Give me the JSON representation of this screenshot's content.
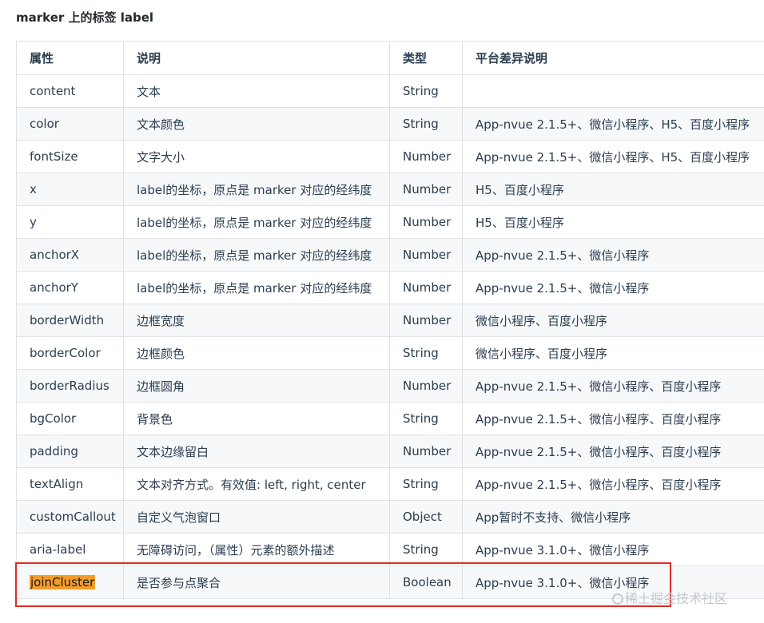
{
  "heading": "marker 上的标签 label",
  "table": {
    "headers": [
      "属性",
      "说明",
      "类型",
      "平台差异说明"
    ],
    "rows": [
      [
        "content",
        "文本",
        "String",
        ""
      ],
      [
        "color",
        "文本颜色",
        "String",
        "App-nvue 2.1.5+、微信小程序、H5、百度小程序"
      ],
      [
        "fontSize",
        "文字大小",
        "Number",
        "App-nvue 2.1.5+、微信小程序、H5、百度小程序"
      ],
      [
        "x",
        "label的坐标，原点是 marker 对应的经纬度",
        "Number",
        "H5、百度小程序"
      ],
      [
        "y",
        "label的坐标，原点是 marker 对应的经纬度",
        "Number",
        "H5、百度小程序"
      ],
      [
        "anchorX",
        "label的坐标，原点是 marker 对应的经纬度",
        "Number",
        "App-nvue 2.1.5+、微信小程序"
      ],
      [
        "anchorY",
        "label的坐标，原点是 marker 对应的经纬度",
        "Number",
        "App-nvue 2.1.5+、微信小程序"
      ],
      [
        "borderWidth",
        "边框宽度",
        "Number",
        "微信小程序、百度小程序"
      ],
      [
        "borderColor",
        "边框颜色",
        "String",
        "微信小程序、百度小程序"
      ],
      [
        "borderRadius",
        "边框圆角",
        "Number",
        "App-nvue 2.1.5+、微信小程序、百度小程序"
      ],
      [
        "bgColor",
        "背景色",
        "String",
        "App-nvue 2.1.5+、微信小程序、百度小程序"
      ],
      [
        "padding",
        "文本边缘留白",
        "Number",
        "App-nvue 2.1.5+、微信小程序、百度小程序"
      ],
      [
        "textAlign",
        "文本对齐方式。有效值: left, right, center",
        "String",
        "App-nvue 2.1.5+、微信小程序、百度小程序"
      ],
      [
        "customCallout",
        "自定义气泡窗口",
        "Object",
        "App暂时不支持、微信小程序"
      ],
      [
        "aria-label",
        "无障碍访问，（属性）元素的额外描述",
        "String",
        "App-nvue 3.1.0+、微信小程序"
      ],
      [
        "joinCluster",
        "是否参与点聚合",
        "Boolean",
        "App-nvue 3.1.0+、微信小程序"
      ]
    ]
  },
  "highlighted_row_index": 15,
  "watermark": "稀土掘金技术社区",
  "colors": {
    "highlight": "#f39c2b",
    "annotation_box": "#d93025",
    "row_stripe": "#f6f8fa",
    "border": "#dfe2e5"
  }
}
